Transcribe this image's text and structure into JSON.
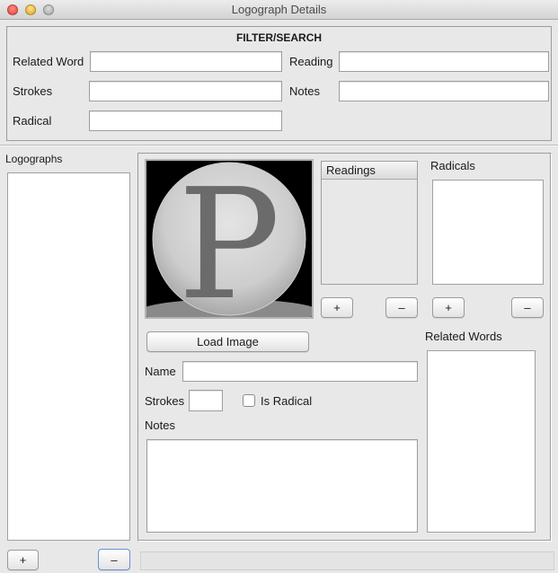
{
  "window": {
    "title": "Logograph Details"
  },
  "filter": {
    "title": "FILTER/SEARCH",
    "related_word_label": "Related Word",
    "reading_label": "Reading",
    "strokes_label": "Strokes",
    "notes_label": "Notes",
    "radical_label": "Radical",
    "related_word_value": "",
    "reading_value": "",
    "strokes_value": "",
    "notes_value": "",
    "radical_value": ""
  },
  "logographs": {
    "label": "Logographs",
    "add_label": "+",
    "remove_label": "–"
  },
  "details": {
    "image_letter": "P",
    "readings_header": "Readings",
    "radicals_label": "Radicals",
    "load_image_label": "Load Image",
    "related_words_label": "Related Words",
    "name_label": "Name",
    "name_value": "",
    "strokes_label": "Strokes",
    "strokes_value": "",
    "is_radical_label": "Is Radical",
    "is_radical_checked": false,
    "notes_label": "Notes",
    "notes_value": "",
    "add_label": "+",
    "remove_label": "–"
  }
}
